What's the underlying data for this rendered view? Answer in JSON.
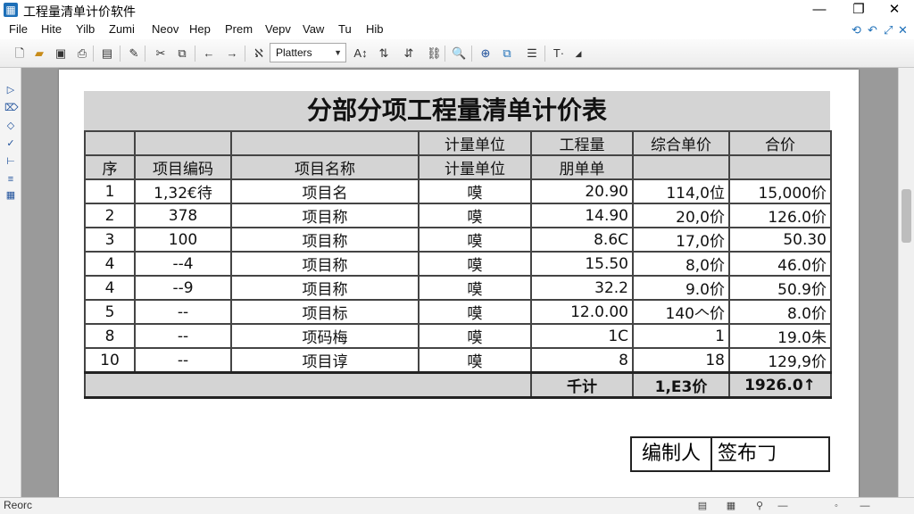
{
  "window": {
    "title": "工程量清单计价软件"
  },
  "menubar": {
    "items": [
      "File",
      "Hite",
      "Yilb",
      "Zumi",
      "Neov",
      "Hep",
      "Prem",
      "Vepv",
      "Vaw",
      "Tu",
      "Hib"
    ]
  },
  "toolbar": {
    "font_select": "Platters"
  },
  "sheet": {
    "title": "分部分项工程量清单计价表",
    "header_row1": [
      "",
      "",
      "",
      "计量单位",
      "工程量",
      "综合单价",
      "合价"
    ],
    "header_row2": [
      "序",
      "项目编码",
      "项目名称",
      "计量单位",
      "朋单单",
      "",
      ""
    ],
    "rows": [
      [
        "1",
        "1,32€待",
        "项目名",
        "嗼",
        "20.90",
        "114,0位",
        "15,000价"
      ],
      [
        "2",
        "378",
        "项目称",
        "嗼",
        "14.90",
        "20,0价",
        "126.0价"
      ],
      [
        "3",
        "100",
        "项目称",
        "嗼",
        "8.6C",
        "17,0价",
        "50.30"
      ],
      [
        "4",
        "--4",
        "项目称",
        "嗼",
        "15.50",
        "8,0价",
        "46.0价"
      ],
      [
        "4",
        "--9",
        "项目称",
        "嗼",
        "32.2",
        "9.0价",
        "50.9价"
      ],
      [
        "5",
        "--",
        "项目标",
        "嗼",
        "12.0.00",
        "140𠆢价",
        "8.0价"
      ],
      [
        "8",
        "--",
        "项码梅",
        "嗼",
        "1C",
        "1",
        "19.0朱"
      ],
      [
        "10",
        "--",
        "项目谆",
        "嗼",
        "8",
        "18",
        "129,9价"
      ]
    ],
    "total": {
      "label": "千计",
      "unit_price": "1,E3价",
      "amount": "1926.0↑"
    }
  },
  "signature": {
    "label": "编制人",
    "value": "签布𠃌"
  },
  "status": {
    "text": "Reorc"
  }
}
